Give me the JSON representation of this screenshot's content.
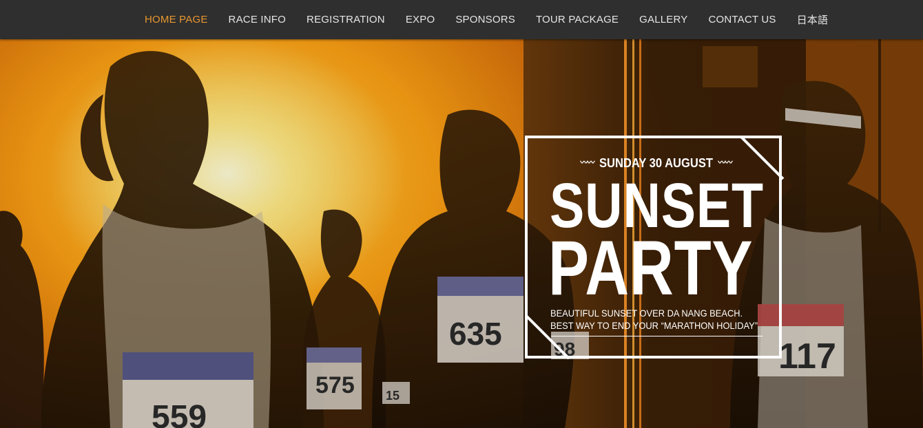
{
  "nav": {
    "items": [
      {
        "label": "HOME PAGE",
        "active": true
      },
      {
        "label": "RACE INFO"
      },
      {
        "label": "REGISTRATION"
      },
      {
        "label": "EXPO"
      },
      {
        "label": "SPONSORS"
      },
      {
        "label": "TOUR PACKAGE"
      },
      {
        "label": "GALLERY"
      },
      {
        "label": "CONTACT US"
      },
      {
        "label": "日本語"
      }
    ]
  },
  "hero": {
    "date": "SUNDAY 30 AUGUST",
    "title_line1": "SUNSET",
    "title_line2": "PARTY",
    "desc_line1": "BEAUTIFUL SUNSET OVER DA NANG BEACH.",
    "desc_line2": "BEST WAY TO END YOUR “MARATHON HOLIDAY”",
    "bibs": [
      "635",
      "575",
      "117",
      "98",
      "15",
      "559"
    ]
  },
  "colors": {
    "accent": "#e8962e",
    "navbar": "#2f2f2f",
    "nav_text": "#e6e6e6"
  }
}
